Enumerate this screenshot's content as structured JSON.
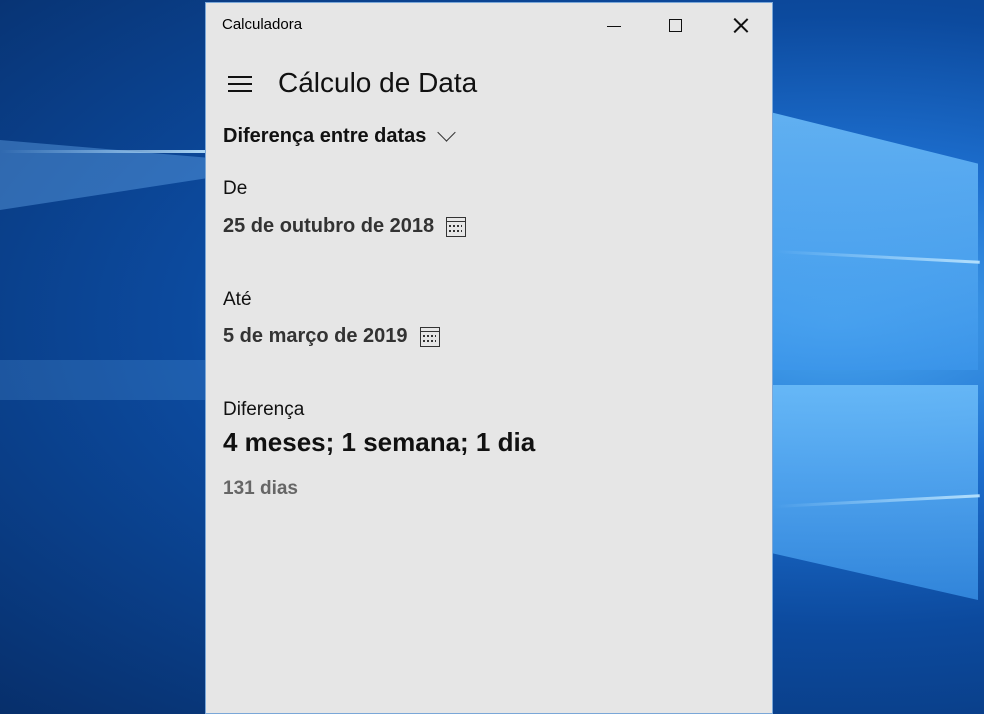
{
  "window": {
    "app_title": "Calculadora",
    "controls": {
      "minimize": "minimize",
      "maximize": "maximize",
      "close": "close"
    }
  },
  "header": {
    "menu_icon": "hamburger-icon",
    "page_title": "Cálculo de Data"
  },
  "mode": {
    "selected": "Diferença entre datas",
    "icon": "chevron-down-icon"
  },
  "from": {
    "label": "De",
    "date": "25 de outubro de 2018",
    "icon": "calendar-icon"
  },
  "to": {
    "label": "Até",
    "date": "5 de março de 2019",
    "icon": "calendar-icon"
  },
  "result": {
    "label": "Diferença",
    "value": "4 meses; 1 semana; 1 dia",
    "days": "131 dias"
  },
  "colors": {
    "window_bg": "#e6e6e6",
    "wallpaper_blue": "#0c4a9e",
    "secondary_text": "#666666"
  }
}
